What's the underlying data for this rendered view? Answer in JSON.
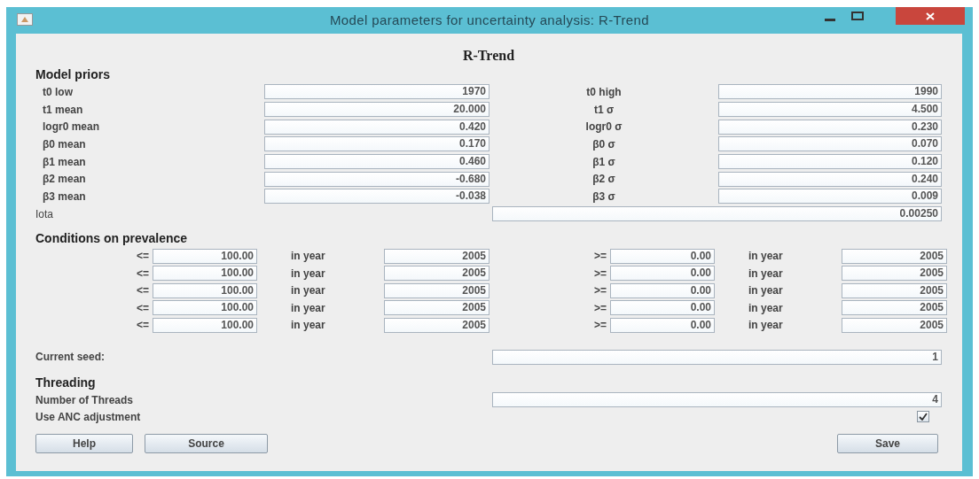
{
  "window": {
    "title": "Model parameters for uncertainty analysis: R-Trend"
  },
  "heading": "R-Trend",
  "priors": {
    "title": "Model priors",
    "rows": [
      {
        "label": "t0 low",
        "value": "1970",
        "label_2": "t0 high",
        "value_2": "1990"
      },
      {
        "label": "t1 mean",
        "value": "20.000",
        "label_2": "t1 σ",
        "value_2": "4.500"
      },
      {
        "label": "logr0 mean",
        "value": "0.420",
        "label_2": "logr0 σ",
        "value_2": "0.230"
      },
      {
        "label": "β0 mean",
        "value": "0.170",
        "label_2": "β0 σ",
        "value_2": "0.070"
      },
      {
        "label": "β1 mean",
        "value": "0.460",
        "label_2": "β1 σ",
        "value_2": "0.120"
      },
      {
        "label": "β2 mean",
        "value": "-0.680",
        "label_2": "β2 σ",
        "value_2": "0.240"
      },
      {
        "label": "β3 mean",
        "value": "-0.038",
        "label_2": "β3 σ",
        "value_2": "0.009"
      }
    ],
    "iota": {
      "label": "Iota",
      "value": "0.00250"
    }
  },
  "conditions": {
    "title": "Conditions on prevalence",
    "rows": [
      {
        "op": "<=",
        "value": "100.00",
        "year_label": "in year",
        "year": "2005",
        "op_2": ">=",
        "value_2": "0.00",
        "year_label_2": "in year",
        "year_2": "2005"
      },
      {
        "op": "<=",
        "value": "100.00",
        "year_label": "in year",
        "year": "2005",
        "op_2": ">=",
        "value_2": "0.00",
        "year_label_2": "in year",
        "year_2": "2005"
      },
      {
        "op": "<=",
        "value": "100.00",
        "year_label": "in year",
        "year": "2005",
        "op_2": ">=",
        "value_2": "0.00",
        "year_label_2": "in year",
        "year_2": "2005"
      },
      {
        "op": "<=",
        "value": "100.00",
        "year_label": "in year",
        "year": "2005",
        "op_2": ">=",
        "value_2": "0.00",
        "year_label_2": "in year",
        "year_2": "2005"
      },
      {
        "op": "<=",
        "value": "100.00",
        "year_label": "in year",
        "year": "2005",
        "op_2": ">=",
        "value_2": "0.00",
        "year_label_2": "in year",
        "year_2": "2005"
      }
    ]
  },
  "seed": {
    "label": "Current seed:",
    "value": "1"
  },
  "threading": {
    "title": "Threading",
    "threads_label": "Number of Threads",
    "threads_value": "4",
    "anc_label": "Use ANC adjustment",
    "anc_checked": true
  },
  "buttons": [
    "Help",
    "Source"
  ],
  "save_button": "Save"
}
